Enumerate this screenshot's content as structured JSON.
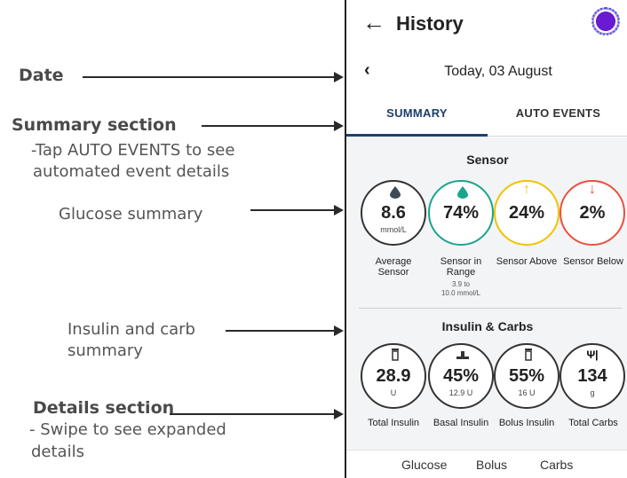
{
  "annotations": {
    "date": {
      "title": "Date"
    },
    "summary": {
      "title": "Summary section",
      "line1": "-Tap AUTO EVENTS to see",
      "line2": "automated event details"
    },
    "glucose": {
      "text": "Glucose summary"
    },
    "insulin": {
      "line1": "Insulin and carb",
      "line2": "summary"
    },
    "details": {
      "title": "Details section",
      "line1": "- Swipe to see expanded",
      "line2": "details"
    }
  },
  "appbar": {
    "title": "History",
    "back_icon": "arrow-left-icon",
    "avatar_icon": "profile-icon"
  },
  "date_row": {
    "text": "Today, 03 August",
    "prev_icon": "chevron-left-icon"
  },
  "tabs": [
    {
      "label": "SUMMARY",
      "selected": true
    },
    {
      "label": "AUTO EVENTS",
      "selected": false
    }
  ],
  "sensor": {
    "title": "Sensor",
    "items": [
      {
        "value": "8.6",
        "unit": "mmol/L",
        "label1": "Average",
        "label2": "Sensor",
        "icon": "drop-icon",
        "color": "#333333"
      },
      {
        "value": "74%",
        "unit": "",
        "label1": "Sensor in",
        "label2": "Range",
        "sub1": "3.9 to",
        "sub2": "10.0 mmol/L",
        "icon": "drop-icon",
        "color": "#1aa58c"
      },
      {
        "value": "24%",
        "unit": "",
        "label1": "Sensor Above",
        "icon": "arrow-up-icon",
        "color": "#f2c200"
      },
      {
        "value": "2%",
        "unit": "",
        "label1": "Sensor Below",
        "icon": "arrow-down-icon",
        "color": "#e9503c"
      }
    ]
  },
  "insulin": {
    "title": "Insulin & Carbs",
    "items": [
      {
        "value": "28.9",
        "unit": "U",
        "label1": "Total Insulin",
        "icon": "vial-icon"
      },
      {
        "value": "45%",
        "unit": "12.9 U",
        "label1": "Basal Insulin",
        "icon": "basal-icon"
      },
      {
        "value": "55%",
        "unit": "16 U",
        "label1": "Bolus Insulin",
        "icon": "vial-icon"
      },
      {
        "value": "134",
        "unit": "g",
        "label1": "Total Carbs",
        "icon": "fork-knife-icon"
      }
    ]
  },
  "details": {
    "columns": [
      "Glucose",
      "Bolus",
      "Carbs"
    ]
  },
  "colors": {
    "accent": "#1c3f6e",
    "in_range": "#1aa58c",
    "above": "#f2c200",
    "below": "#e9503c",
    "avatar": "#6a1bd1"
  }
}
